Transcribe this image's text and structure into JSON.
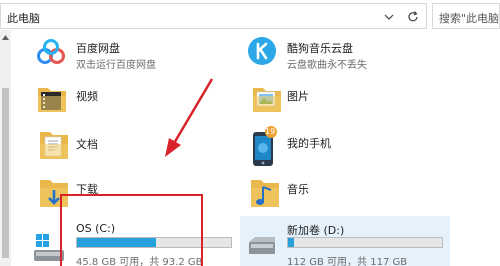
{
  "address_bar": {
    "path": "此电脑"
  },
  "search": {
    "placeholder": "搜索\"此电脑\""
  },
  "items": {
    "baidu": {
      "title": "百度网盘",
      "subtitle": "双击运行百度网盘"
    },
    "kugou": {
      "title": "酷狗音乐云盘",
      "subtitle": "云盘歌曲永不丢失"
    },
    "videos": {
      "title": "视频"
    },
    "pictures": {
      "title": "图片"
    },
    "documents": {
      "title": "文档"
    },
    "phone": {
      "title": "我的手机",
      "badge": "19"
    },
    "downloads": {
      "title": "下载"
    },
    "music": {
      "title": "音乐"
    }
  },
  "drives": [
    {
      "title": "OS (C:)",
      "usage": "45.8 GB 可用，共 93.2 GB",
      "fill_fraction": 0.51
    },
    {
      "title": "新加卷 (D:)",
      "usage": "112 GB 可用，共 117 GB",
      "fill_fraction": 0.04
    }
  ],
  "colors": {
    "accent": "#26a0da",
    "annotation": "#d8232a",
    "selection": "#e5f1fb"
  }
}
